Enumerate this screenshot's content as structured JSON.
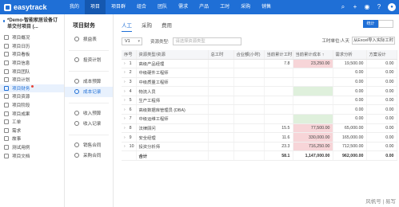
{
  "brand": {
    "name": "easytrack"
  },
  "nav": [
    "我的",
    "项目",
    "项目群",
    "组合",
    "团队",
    "需求",
    "产品",
    "工时",
    "采购",
    "销售"
  ],
  "nav_active_index": 1,
  "project": {
    "title": "*Demo-智能家居设备订单交付项目 (..."
  },
  "sidebar": [
    {
      "label": "项目概况",
      "active": false,
      "dot": false
    },
    {
      "label": "项目日历",
      "active": false,
      "dot": false
    },
    {
      "label": "项目看板",
      "active": false,
      "dot": false
    },
    {
      "label": "项目信息",
      "active": false,
      "dot": false
    },
    {
      "label": "项目团队",
      "active": false,
      "dot": false
    },
    {
      "label": "项目计划",
      "active": false,
      "dot": false
    },
    {
      "label": "项目财务",
      "active": true,
      "dot": true
    },
    {
      "label": "项目资源",
      "active": false,
      "dot": false
    },
    {
      "label": "项目阶段",
      "active": false,
      "dot": false
    },
    {
      "label": "项目成果",
      "active": false,
      "dot": false
    },
    {
      "label": "工单",
      "active": false,
      "dot": false
    },
    {
      "label": "需求",
      "active": false,
      "dot": false
    },
    {
      "label": "故事",
      "active": false,
      "dot": false
    },
    {
      "label": "测试用例",
      "active": false,
      "dot": false
    },
    {
      "label": "项目文档",
      "active": false,
      "dot": false
    }
  ],
  "subpanel": {
    "title": "项目财务",
    "groups": [
      [
        {
          "label": "损益表",
          "active": false,
          "dot": false
        }
      ],
      [
        {
          "label": "投资计划",
          "active": false,
          "dot": false
        }
      ],
      [
        {
          "label": "成本预算",
          "active": false,
          "dot": true
        },
        {
          "label": "成本记录",
          "active": true,
          "dot": false
        }
      ],
      [
        {
          "label": "收入预算",
          "active": false,
          "dot": false
        },
        {
          "label": "收入记录",
          "active": false,
          "dot": false
        }
      ],
      [
        {
          "label": "销售合同",
          "active": false,
          "dot": false
        },
        {
          "label": "采购合同",
          "active": false,
          "dot": false
        }
      ]
    ]
  },
  "tabs": [
    {
      "label": "人工",
      "active": true
    },
    {
      "label": "采购",
      "active": false
    },
    {
      "label": "费用",
      "active": false
    }
  ],
  "view_buttons": [
    {
      "label": "统计",
      "active": true
    },
    {
      "label": "",
      "active": false
    }
  ],
  "toolbar": {
    "version": "V1",
    "resource_type_label": "资源类型:",
    "resource_type_placeholder": "请选择资源类型",
    "unit_label": "工时单位:人天",
    "excel_label": "从Excel导入实际工时"
  },
  "table": {
    "headers": [
      "序号",
      "资源类型/资源",
      "总工时",
      "合业额(小时)",
      "当前累计工时",
      "当前累计成本 ↑",
      "需求分析",
      "方案设计"
    ],
    "rows": [
      {
        "no": "1",
        "name": "高级产品经理",
        "total": "",
        "amount": "",
        "cum_hours": "7.8",
        "cum_cost": "23,250.00",
        "cost_flag": "red",
        "req": "19,500.00",
        "design": "0.00"
      },
      {
        "no": "2",
        "name": "中级硬件工程师",
        "total": "",
        "amount": "",
        "cum_hours": "",
        "cum_cost": "",
        "cost_flag": "",
        "req": "0.00",
        "design": "0.00"
      },
      {
        "no": "3",
        "name": "中级质量工程师",
        "total": "",
        "amount": "",
        "cum_hours": "",
        "cum_cost": "",
        "cost_flag": "",
        "req": "0.00",
        "design": "0.00"
      },
      {
        "no": "4",
        "name": "物流人员",
        "total": "",
        "amount": "",
        "cum_hours": "",
        "cum_cost": "",
        "cost_flag": "green",
        "req": "0.00",
        "design": "0.00"
      },
      {
        "no": "5",
        "name": "生产工程师",
        "total": "",
        "amount": "",
        "cum_hours": "",
        "cum_cost": "",
        "cost_flag": "",
        "req": "0.00",
        "design": "0.00"
      },
      {
        "no": "6",
        "name": "高级数据库管理员 (DBA)",
        "total": "",
        "amount": "",
        "cum_hours": "",
        "cum_cost": "",
        "cost_flag": "",
        "req": "0.00",
        "design": "0.00"
      },
      {
        "no": "7",
        "name": "中级运维工程师",
        "total": "",
        "amount": "",
        "cum_hours": "",
        "cum_cost": "",
        "cost_flag": "green",
        "req": "0.00",
        "design": "0.00"
      },
      {
        "no": "8",
        "name": "法律顾问",
        "total": "",
        "amount": "",
        "cum_hours": "15.5",
        "cum_cost": "77,500.00",
        "cost_flag": "red",
        "req": "65,000.00",
        "design": "0.00"
      },
      {
        "no": "9",
        "name": "安全经理",
        "total": "",
        "amount": "",
        "cum_hours": "11.6",
        "cum_cost": "330,000.00",
        "cost_flag": "red",
        "req": "165,000.00",
        "design": "0.00"
      },
      {
        "no": "10",
        "name": "投资分析师",
        "total": "",
        "amount": "",
        "cum_hours": "23.3",
        "cum_cost": "716,250.00",
        "cost_flag": "red",
        "req": "712,500.00",
        "design": "0.00"
      }
    ],
    "total_row": {
      "label": "合计",
      "cum_hours": "58.1",
      "cum_cost": "1,147,000.00",
      "req": "962,000.00",
      "design": "0.00"
    }
  },
  "watermark": "风帆号 | 易写",
  "colors": {
    "accent": "#1f6fd6",
    "red_cell": "#f7d5d8",
    "green_cell": "#dff0dc"
  }
}
